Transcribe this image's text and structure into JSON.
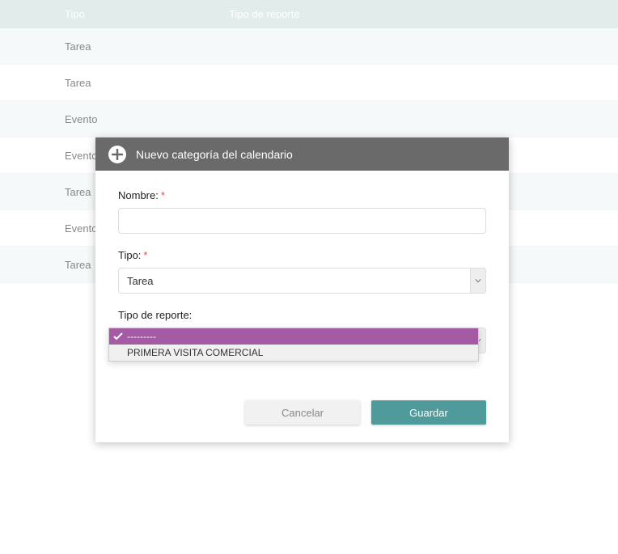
{
  "table": {
    "headers": {
      "tipo": "Tipo",
      "reporte": "Tipo de reporte"
    },
    "rows": [
      {
        "tipo": "Tarea"
      },
      {
        "tipo": "Tarea"
      },
      {
        "tipo": "Evento"
      },
      {
        "tipo": "Evento"
      },
      {
        "tipo": "Tarea"
      },
      {
        "tipo": "Evento"
      },
      {
        "tipo": "Tarea"
      }
    ]
  },
  "modal": {
    "title": "Nuevo categoría del calendario",
    "form": {
      "nombre_label": "Nombre:",
      "nombre_value": "",
      "tipo_label": "Tipo:",
      "tipo_value": "Tarea",
      "reporte_label": "Tipo de reporte:",
      "reporte_value": ""
    },
    "dropdown": {
      "opt0": "---------",
      "opt1": "PRIMERA VISITA COMERCIAL"
    },
    "buttons": {
      "cancel": "Cancelar",
      "save": "Guardar"
    }
  }
}
